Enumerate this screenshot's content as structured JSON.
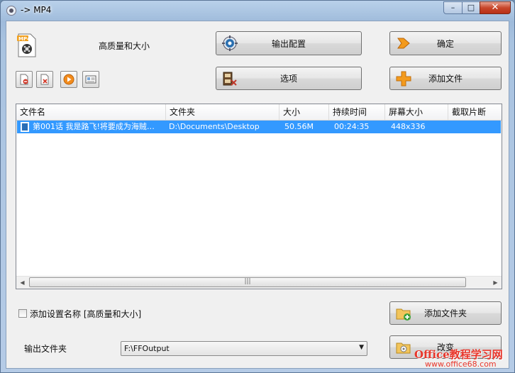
{
  "window": {
    "title": "-> MP4",
    "close_glyph": "✕",
    "min_glyph": "–",
    "max_glyph": "□"
  },
  "preset": {
    "label": "高质量和大小"
  },
  "buttons": {
    "output_config": "输出配置",
    "ok": "确定",
    "options": "选项",
    "add_file": "添加文件",
    "add_folder": "添加文件夹",
    "change": "改变"
  },
  "toolbar": [
    {
      "name": "remove-icon"
    },
    {
      "name": "clear-icon"
    },
    {
      "name": "play-icon"
    },
    {
      "name": "info-icon"
    }
  ],
  "file_list": {
    "columns": [
      "文件名",
      "文件夹",
      "大小",
      "持续时间",
      "屏幕大小",
      "截取片断"
    ],
    "rows": [
      {
        "name": "第001话 我是路飞!将要成为海贼…",
        "folder": "D:\\Documents\\Desktop",
        "size": "50.56M",
        "duration": "00:24:35",
        "screen": "448x336",
        "clip": ""
      }
    ],
    "scroll_grip": "|||"
  },
  "options": {
    "append_setting_name_label": "添加设置名称 [高质量和大小]",
    "append_checked": false
  },
  "output": {
    "label": "输出文件夹",
    "path": "F:\\FFOutput"
  },
  "watermark": {
    "title": "Office教程学习网",
    "url": "www.office68.com"
  },
  "colors": {
    "selection": "#3399ff",
    "watermark": "#e8362b"
  }
}
